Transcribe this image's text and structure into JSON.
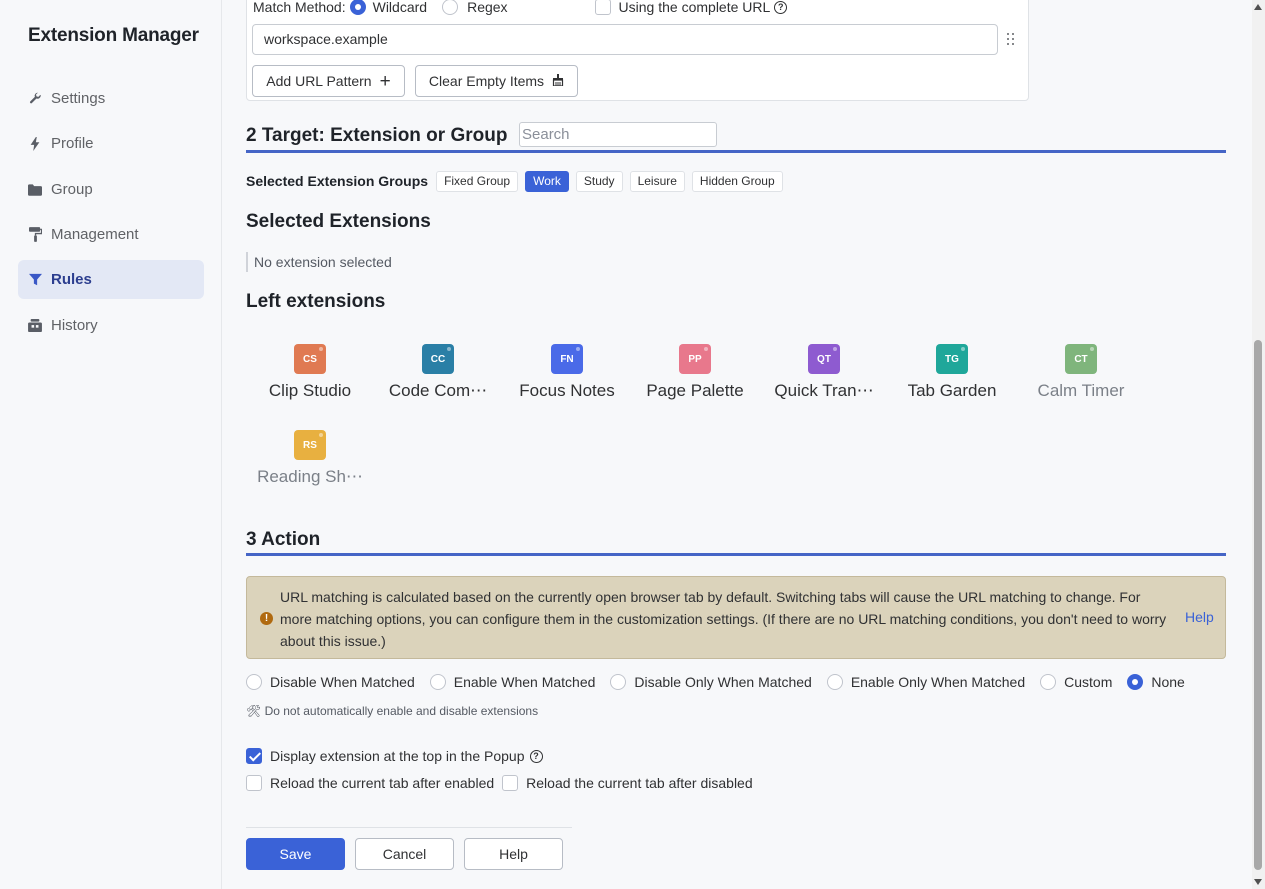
{
  "app": {
    "title": "Extension Manager"
  },
  "sidebar": {
    "items": [
      {
        "label": "Settings",
        "icon": "wrench-icon",
        "active": false
      },
      {
        "label": "Profile",
        "icon": "bolt-icon",
        "active": false
      },
      {
        "label": "Group",
        "icon": "folder-icon",
        "active": false
      },
      {
        "label": "Management",
        "icon": "paint-roller-icon",
        "active": false
      },
      {
        "label": "Rules",
        "icon": "funnel-icon",
        "active": true
      },
      {
        "label": "History",
        "icon": "history-icon",
        "active": false
      }
    ]
  },
  "url_section": {
    "match_method_label": "Match Method:",
    "options": [
      "Wildcard",
      "Regex"
    ],
    "selected": "Wildcard",
    "complete_url_label": "Using the complete URL",
    "complete_url_checked": false,
    "pattern_value": "workspace.example",
    "add_pattern_label": "Add URL Pattern",
    "clear_empty_label": "Clear Empty Items"
  },
  "target_section": {
    "heading": "2 Target: Extension or Group",
    "search_placeholder": "Search",
    "groups_label": "Selected Extension Groups",
    "groups": [
      {
        "label": "Fixed Group",
        "active": false
      },
      {
        "label": "Work",
        "active": true
      },
      {
        "label": "Study",
        "active": false
      },
      {
        "label": "Leisure",
        "active": false
      },
      {
        "label": "Hidden Group",
        "active": false
      }
    ],
    "selected_extensions_heading": "Selected Extensions",
    "no_selection_text": "No extension selected",
    "left_extensions_heading": "Left extensions",
    "extensions": [
      {
        "abbr": "CS",
        "name": "Clip Studio",
        "color": "#e07a52",
        "disabled": false
      },
      {
        "abbr": "CC",
        "name": "Code Com⋯",
        "color": "#2a7fa6",
        "disabled": false
      },
      {
        "abbr": "FN",
        "name": "Focus Notes",
        "color": "#4a6ae8",
        "disabled": false
      },
      {
        "abbr": "PP",
        "name": "Page Palette",
        "color": "#e8788c",
        "disabled": false
      },
      {
        "abbr": "QT",
        "name": "Quick Tran⋯",
        "color": "#8e5bd0",
        "disabled": false
      },
      {
        "abbr": "TG",
        "name": "Tab Garden",
        "color": "#1fa79a",
        "disabled": false
      },
      {
        "abbr": "CT",
        "name": "Calm Timer",
        "color": "#7fb57c",
        "disabled": true
      },
      {
        "abbr": "RS",
        "name": "Reading Sh⋯",
        "color": "#e8b040",
        "disabled": true
      }
    ]
  },
  "action_section": {
    "heading": "3 Action",
    "alert_text": "URL matching is calculated based on the currently open browser tab by default. Switching tabs will cause the URL matching to change. For more matching options, you can configure them in the customization settings. (If there are no URL matching conditions, you don't need to worry about this issue.)",
    "alert_help": "Help",
    "options": [
      {
        "label": "Disable When Matched",
        "selected": false
      },
      {
        "label": "Enable When Matched",
        "selected": false
      },
      {
        "label": "Disable Only When Matched",
        "selected": false
      },
      {
        "label": "Enable Only When Matched",
        "selected": false
      },
      {
        "label": "Custom",
        "selected": false
      },
      {
        "label": "None",
        "selected": true
      }
    ],
    "note": "🛠 Do not automatically enable and disable extensions",
    "display_top_label": "Display extension at the top in the Popup",
    "display_top_checked": true,
    "reload_enabled_label": "Reload the current tab after enabled",
    "reload_enabled_checked": false,
    "reload_disabled_label": "Reload the current tab after disabled",
    "reload_disabled_checked": false
  },
  "footer": {
    "save": "Save",
    "cancel": "Cancel",
    "help": "Help"
  },
  "colors": {
    "accent": "#3a62d7",
    "rule": "#4565c6",
    "alert_bg": "#dbd3bb"
  }
}
